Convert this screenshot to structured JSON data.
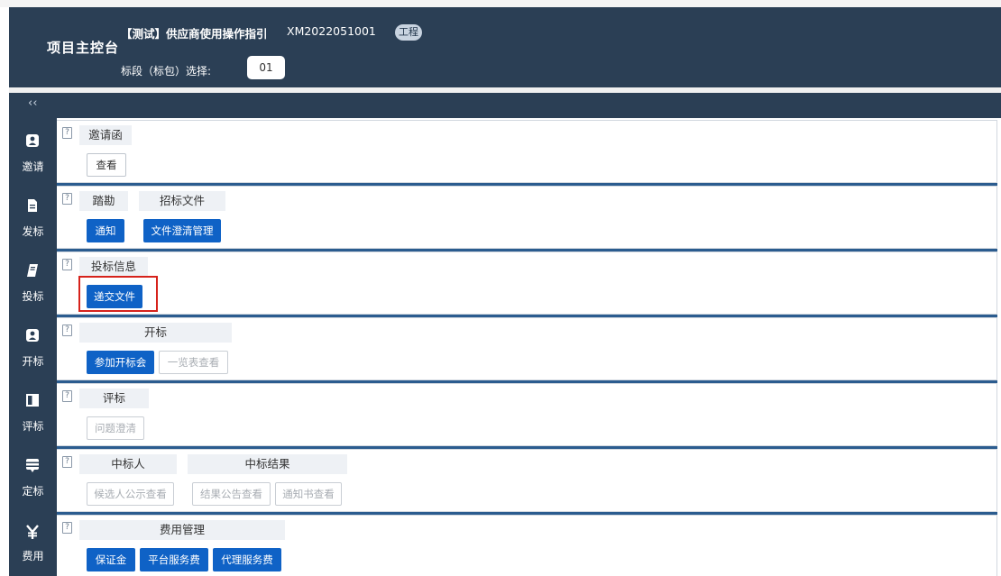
{
  "header": {
    "console_title": "项目主控台",
    "project_name": "【测试】供应商使用操作指引",
    "project_code": "XM2022051001",
    "project_tag": "工程",
    "section_label": "标段（标包）选择:",
    "section_value": "01"
  },
  "collapse_label": "‹‹",
  "nav": [
    {
      "label": "邀请"
    },
    {
      "label": "发标"
    },
    {
      "label": "投标"
    },
    {
      "label": "开标"
    },
    {
      "label": "评标"
    },
    {
      "label": "定标"
    },
    {
      "label": "费用"
    }
  ],
  "help_glyph": "?",
  "rows": [
    {
      "labels": [
        "邀请函"
      ],
      "buttons": [
        "查看"
      ]
    },
    {
      "labels": [
        "踏勘",
        "招标文件"
      ],
      "buttons": [
        "通知",
        "文件澄清管理"
      ]
    },
    {
      "labels": [
        "投标信息"
      ],
      "buttons": [
        "递交文件"
      ]
    },
    {
      "labels": [
        "开标"
      ],
      "buttons": [
        "参加开标会",
        "一览表查看"
      ]
    },
    {
      "labels": [
        "评标"
      ],
      "buttons": [
        "问题澄清"
      ]
    },
    {
      "labels": [
        "中标人",
        "中标结果"
      ],
      "buttons": [
        "候选人公示查看",
        "结果公告查看",
        "通知书查看"
      ]
    },
    {
      "labels": [
        "费用管理"
      ],
      "buttons": [
        "保证金",
        "平台服务费",
        "代理服务费"
      ]
    }
  ],
  "colors": {
    "header_bg": "#2b3f55",
    "primary_button": "#0f62c6",
    "row_separator": "#2b5c8f",
    "highlight": "#d6221b"
  },
  "icons": [
    "user-badge-icon",
    "document-icon",
    "book-icon",
    "user-badge-icon",
    "board-icon",
    "list-icon",
    "yen-icon"
  ]
}
